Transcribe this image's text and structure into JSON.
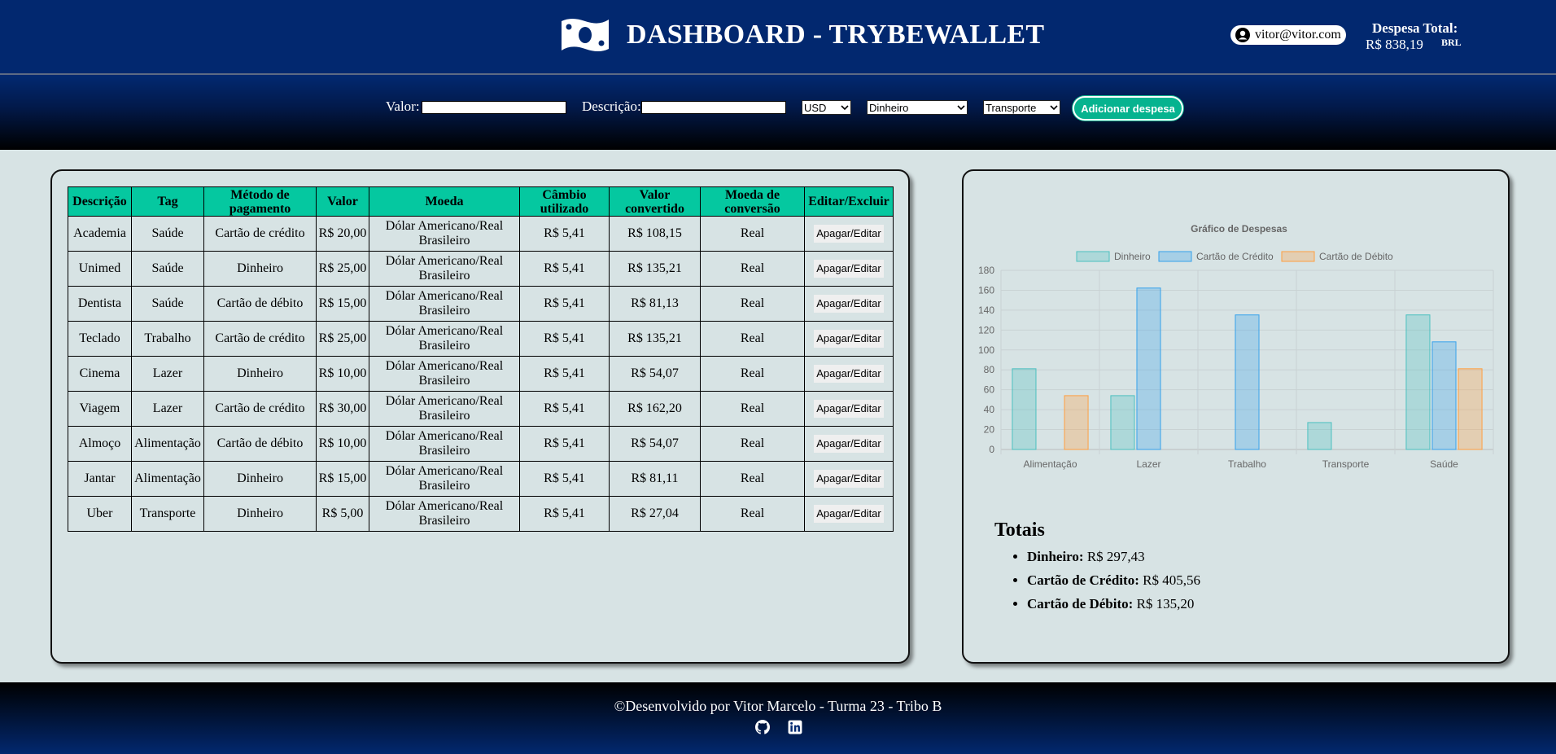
{
  "header": {
    "title": "DASHBOARD - TRYBEWALLET",
    "user_email": "vitor@vitor.com",
    "total_label": "Despesa Total:",
    "total_value": "R$ 838,19",
    "currency": "BRL"
  },
  "form": {
    "valor_label": "Valor:",
    "valor_value": "",
    "descricao_label": "Descrição:",
    "descricao_value": "",
    "currency_selected": "USD",
    "method_selected": "Dinheiro",
    "tag_selected": "Transporte",
    "add_button": "Adicionar despesa"
  },
  "table": {
    "headers": [
      "Descrição",
      "Tag",
      "Método de pagamento",
      "Valor",
      "Moeda",
      "Câmbio utilizado",
      "Valor convertido",
      "Moeda de conversão",
      "Editar/Excluir"
    ],
    "action_label": "Apagar/Editar",
    "rows": [
      [
        "Academia",
        "Saúde",
        "Cartão de crédito",
        "R$ 20,00",
        "Dólar Americano/Real Brasileiro",
        "R$ 5,41",
        "R$ 108,15",
        "Real"
      ],
      [
        "Unimed",
        "Saúde",
        "Dinheiro",
        "R$ 25,00",
        "Dólar Americano/Real Brasileiro",
        "R$ 5,41",
        "R$ 135,21",
        "Real"
      ],
      [
        "Dentista",
        "Saúde",
        "Cartão de débito",
        "R$ 15,00",
        "Dólar Americano/Real Brasileiro",
        "R$ 5,41",
        "R$ 81,13",
        "Real"
      ],
      [
        "Teclado",
        "Trabalho",
        "Cartão de crédito",
        "R$ 25,00",
        "Dólar Americano/Real Brasileiro",
        "R$ 5,41",
        "R$ 135,21",
        "Real"
      ],
      [
        "Cinema",
        "Lazer",
        "Dinheiro",
        "R$ 10,00",
        "Dólar Americano/Real Brasileiro",
        "R$ 5,41",
        "R$ 54,07",
        "Real"
      ],
      [
        "Viagem",
        "Lazer",
        "Cartão de crédito",
        "R$ 30,00",
        "Dólar Americano/Real Brasileiro",
        "R$ 5,41",
        "R$ 162,20",
        "Real"
      ],
      [
        "Almoço",
        "Alimentação",
        "Cartão de débito",
        "R$ 10,00",
        "Dólar Americano/Real Brasileiro",
        "R$ 5,41",
        "R$ 54,07",
        "Real"
      ],
      [
        "Jantar",
        "Alimentação",
        "Dinheiro",
        "R$ 15,00",
        "Dólar Americano/Real Brasileiro",
        "R$ 5,41",
        "R$ 81,11",
        "Real"
      ],
      [
        "Uber",
        "Transporte",
        "Dinheiro",
        "R$ 5,00",
        "Dólar Americano/Real Brasileiro",
        "R$ 5,41",
        "R$ 27,04",
        "Real"
      ]
    ]
  },
  "chart_data": {
    "type": "bar",
    "title": "Gráfico de Despesas",
    "categories": [
      "Alimentação",
      "Lazer",
      "Trabalho",
      "Transporte",
      "Saúde"
    ],
    "series": [
      {
        "name": "Dinheiro",
        "values": [
          81.11,
          54.07,
          0,
          27.04,
          135.21
        ],
        "color": "#4bc0c0"
      },
      {
        "name": "Cartão de Crédito",
        "values": [
          0,
          162.2,
          135.21,
          0,
          108.15
        ],
        "color": "#36a2eb"
      },
      {
        "name": "Cartão de Débito",
        "values": [
          54.07,
          0,
          0,
          0,
          81.13
        ],
        "color": "#ff9f40"
      }
    ],
    "ylim": [
      0,
      180
    ],
    "yticks": [
      0,
      20,
      40,
      60,
      80,
      100,
      120,
      140,
      160,
      180
    ],
    "grid": true,
    "legend": "top"
  },
  "totals": {
    "title": "Totais",
    "items": [
      {
        "label": "Dinheiro:",
        "value": "R$ 297,43"
      },
      {
        "label": "Cartão de Crédito:",
        "value": "R$ 405,56"
      },
      {
        "label": "Cartão de Débito:",
        "value": "R$ 135,20"
      }
    ]
  },
  "footer": {
    "text": "©Desenvolvido por Vitor Marcelo - Turma 23 - Tribo B",
    "icons": [
      "github-icon",
      "linkedin-icon"
    ]
  }
}
